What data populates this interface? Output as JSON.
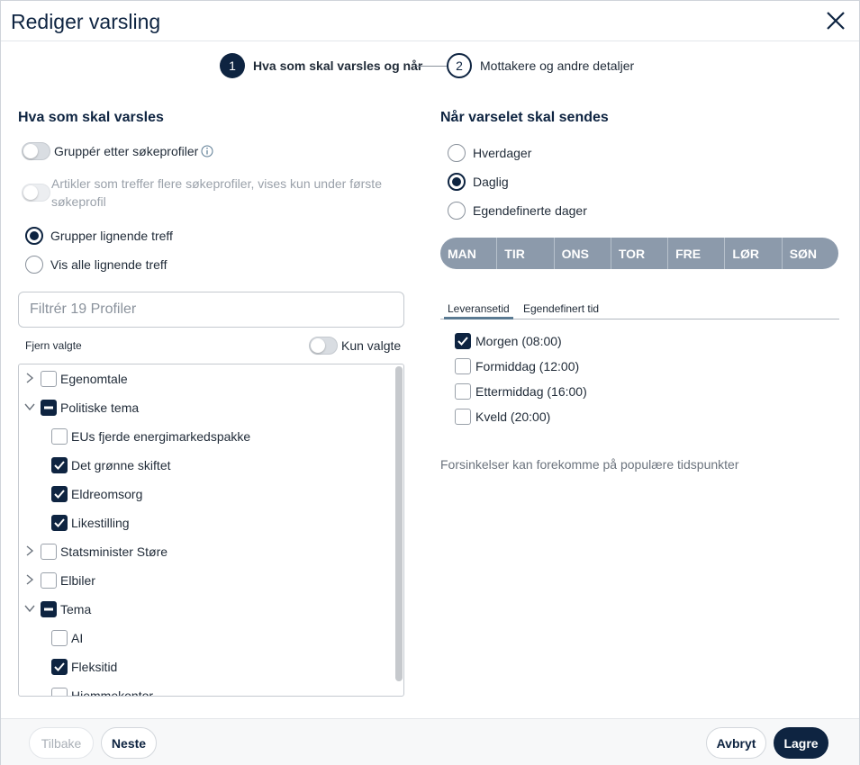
{
  "header": {
    "title": "Rediger varsling"
  },
  "stepper": {
    "steps": [
      {
        "number": "1",
        "label": "Hva som skal varsles og når"
      },
      {
        "number": "2",
        "label": "Mottakere og andre detaljer"
      }
    ]
  },
  "left": {
    "section_title": "Hva som skal varsles",
    "group_by_profiles_label": "Gruppér etter søkeprofiler",
    "multi_profile_note": "Artikler som treffer flere søkeprofiler, vises kun under første søkeprofil",
    "radio_group_similar": "Grupper lignende treff",
    "radio_show_all": "Vis alle lignende treff",
    "filter_placeholder": "Filtrér 19 Profiler",
    "clear_selected": "Fjern valgte",
    "only_selected": "Kun valgte",
    "tree": [
      {
        "label": "Egenomtale",
        "level": 0,
        "expand": "collapsed",
        "state": "unchecked"
      },
      {
        "label": "Politiske tema",
        "level": 0,
        "expand": "expanded",
        "state": "partial"
      },
      {
        "label": "EUs fjerde energimarkedspakke",
        "level": 1,
        "expand": "none",
        "state": "unchecked"
      },
      {
        "label": "Det grønne skiftet",
        "level": 1,
        "expand": "none",
        "state": "checked"
      },
      {
        "label": "Eldreomsorg",
        "level": 1,
        "expand": "none",
        "state": "checked"
      },
      {
        "label": "Likestilling",
        "level": 1,
        "expand": "none",
        "state": "checked"
      },
      {
        "label": "Statsminister Støre",
        "level": 0,
        "expand": "collapsed",
        "state": "unchecked"
      },
      {
        "label": "Elbiler",
        "level": 0,
        "expand": "collapsed",
        "state": "unchecked"
      },
      {
        "label": "Tema",
        "level": 0,
        "expand": "expanded",
        "state": "partial"
      },
      {
        "label": "AI",
        "level": 1,
        "expand": "none",
        "state": "unchecked"
      },
      {
        "label": "Fleksitid",
        "level": 1,
        "expand": "none",
        "state": "checked"
      },
      {
        "label": "Hjemmekontor",
        "level": 1,
        "expand": "none",
        "state": "unchecked"
      }
    ]
  },
  "right": {
    "section_title": "Når varselet skal sendes",
    "radio_weekdays": "Hverdager",
    "radio_daily": "Daglig",
    "radio_custom_days": "Egendefinerte dager",
    "days": [
      "MAN",
      "TIR",
      "ONS",
      "TOR",
      "FRE",
      "LØR",
      "SØN"
    ],
    "tabs": [
      {
        "label": "Leveransetid",
        "active": true
      },
      {
        "label": "Egendefinert tid",
        "active": false
      }
    ],
    "times": [
      {
        "label": "Morgen (08:00)",
        "checked": true
      },
      {
        "label": "Formiddag (12:00)",
        "checked": false
      },
      {
        "label": "Ettermiddag (16:00)",
        "checked": false
      },
      {
        "label": "Kveld (20:00)",
        "checked": false
      }
    ],
    "note": "Forsinkelser kan forekomme på populære tidspunkter"
  },
  "footer": {
    "back": "Tilbake",
    "next": "Neste",
    "cancel": "Avbryt",
    "save": "Lagre"
  },
  "colors": {
    "primary": "#0e2441",
    "days_bar": "#8c9aab",
    "tab_accent": "#5a7a92"
  }
}
